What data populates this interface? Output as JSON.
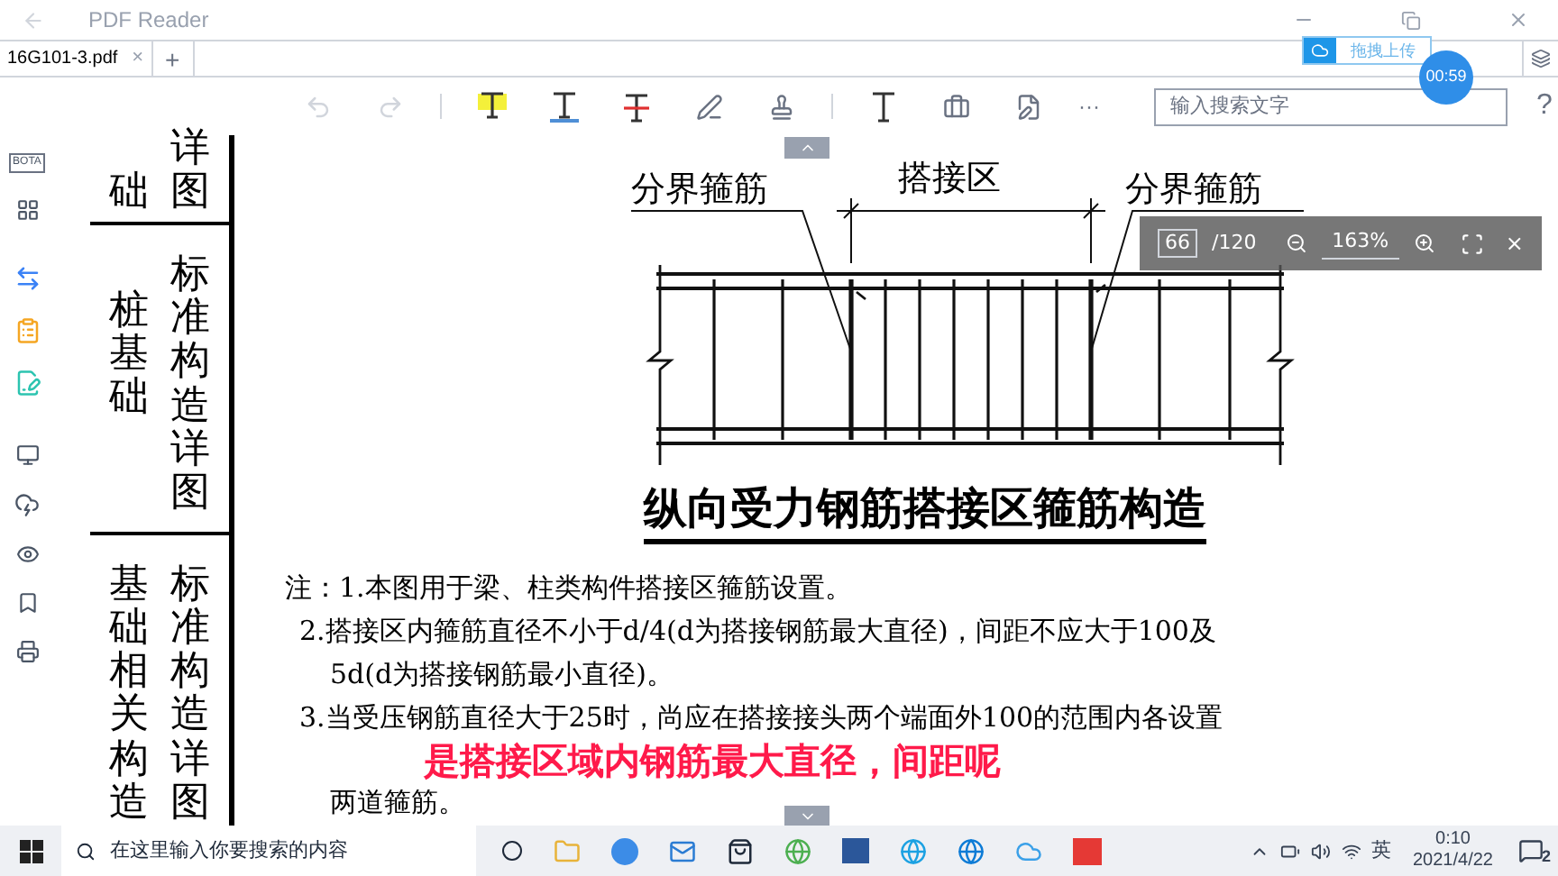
{
  "window": {
    "title": "PDF Reader"
  },
  "tabs": [
    {
      "label": "16G101-3.pdf",
      "selected": true,
      "close": "×"
    }
  ],
  "new_tab": "+",
  "upload_badge": {
    "label": "拖拽上传"
  },
  "timer": "00:59",
  "toolbar": {
    "more": "···",
    "search": {
      "placeholder": "输入搜索文字"
    },
    "help": "?"
  },
  "left_rail": {
    "bota_label": "BOTA"
  },
  "document": {
    "chapter_column": [
      {
        "left": "础",
        "right": "详图"
      },
      {
        "left": "桩基础",
        "right": "标准构造详图"
      },
      {
        "left": "基础相关构造",
        "right": "标准构造详图"
      }
    ],
    "figure": {
      "left_label": "分界箍筋",
      "lap_label": "搭接区",
      "right_label": "分界箍筋",
      "title": "纵向受力钢筋搭接区箍筋构造"
    },
    "notes_prefix": "注：",
    "notes": [
      {
        "lines": [
          "1.本图用于梁、柱类构件搭接区箍筋设置。"
        ]
      },
      {
        "lines": [
          "2.搭接区内箍筋直径不小于d/4(d为搭接钢筋最大直径)，间距不应大于100及",
          "5d(d为搭接钢筋最小直径)。"
        ]
      },
      {
        "lines": [
          "3.当受压钢筋直径大于25时，尚应在搭接接头两个端面外100的范围内各设置",
          "两道箍筋。"
        ]
      }
    ]
  },
  "zoom_bar": {
    "page": "66",
    "total": "/120",
    "zoom": "163%",
    "close": "×"
  },
  "subtitle": "是搭接区域内钢筋最大直径，间距呢",
  "taskbar": {
    "search": {
      "placeholder": "在这里输入你要搜索的内容"
    },
    "ime": "英",
    "time": "0:10",
    "date": "2021/4/22",
    "notifications": "2"
  }
}
